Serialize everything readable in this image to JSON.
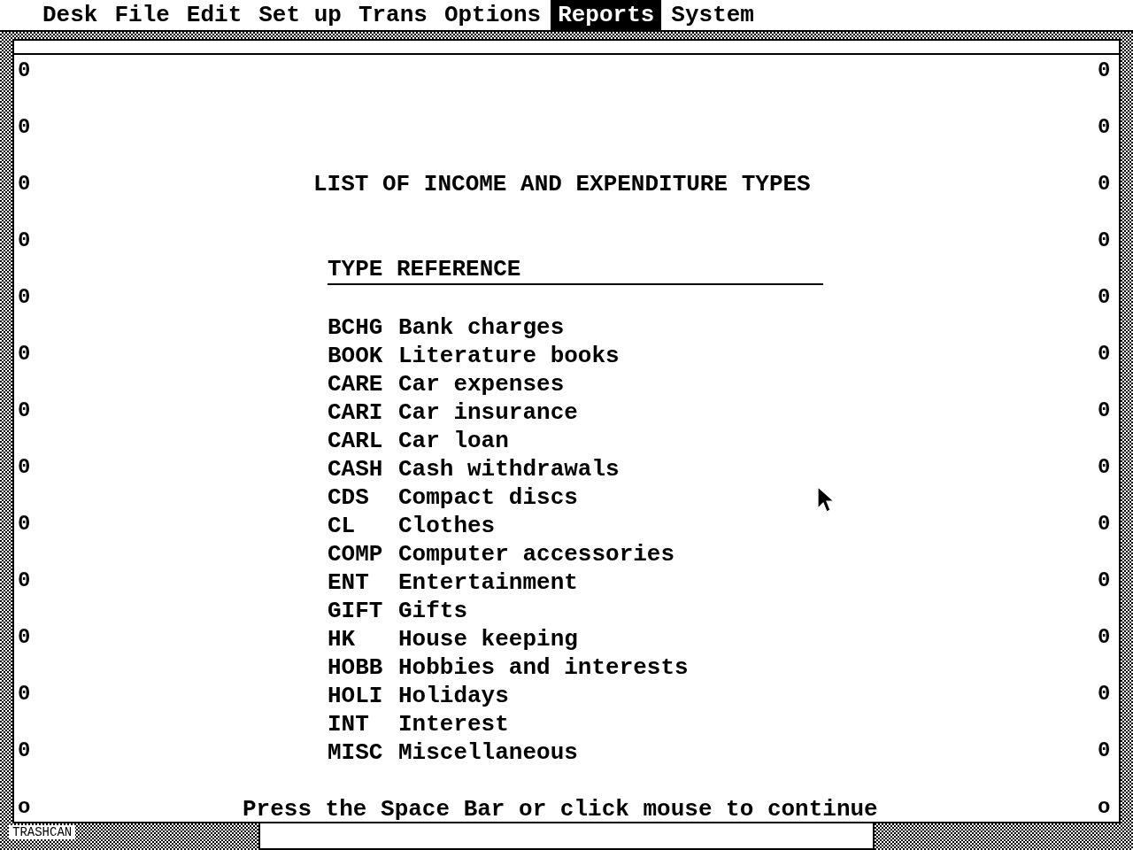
{
  "menu_bar": [
    {
      "label": "Desk",
      "selected": false
    },
    {
      "label": "File",
      "selected": false
    },
    {
      "label": "Edit",
      "selected": false
    },
    {
      "label": "Set up",
      "selected": false
    },
    {
      "label": "Trans",
      "selected": false
    },
    {
      "label": "Options",
      "selected": false
    },
    {
      "label": "Reports",
      "selected": true
    },
    {
      "label": "System",
      "selected": false
    }
  ],
  "report": {
    "title": "LIST OF INCOME AND EXPENDITURE TYPES",
    "header": "TYPE REFERENCE",
    "rows": [
      {
        "code": "BCHG",
        "description": "Bank charges"
      },
      {
        "code": "BOOK",
        "description": "Literature books"
      },
      {
        "code": "CARE",
        "description": "Car expenses"
      },
      {
        "code": "CARI",
        "description": "Car insurance"
      },
      {
        "code": "CARL",
        "description": "Car loan"
      },
      {
        "code": "CASH",
        "description": "Cash withdrawals"
      },
      {
        "code": "CDS",
        "description": "Compact discs"
      },
      {
        "code": "CL",
        "description": "Clothes"
      },
      {
        "code": "COMP",
        "description": "Computer accessories"
      },
      {
        "code": "ENT",
        "description": "Entertainment"
      },
      {
        "code": "GIFT",
        "description": "Gifts"
      },
      {
        "code": "HK",
        "description": "House keeping"
      },
      {
        "code": "HOBB",
        "description": "Hobbies and interests"
      },
      {
        "code": "HOLI",
        "description": "Holidays"
      },
      {
        "code": "INT",
        "description": "Interest"
      },
      {
        "code": "MISC",
        "description": "Miscellaneous"
      }
    ],
    "prompt": "Press the Space Bar or click mouse to continue",
    "left_marks": [
      "0",
      "0",
      "0",
      "0",
      "0",
      "0",
      "0",
      "0",
      "0",
      "0",
      "0",
      "0",
      "0",
      "o"
    ],
    "right_marks": [
      "0",
      "0",
      "0",
      "0",
      "0",
      "0",
      "0",
      "0",
      "0",
      "0",
      "0",
      "0",
      "0",
      "o"
    ]
  },
  "desktop": {
    "trash_label": "TRASHCAN"
  }
}
